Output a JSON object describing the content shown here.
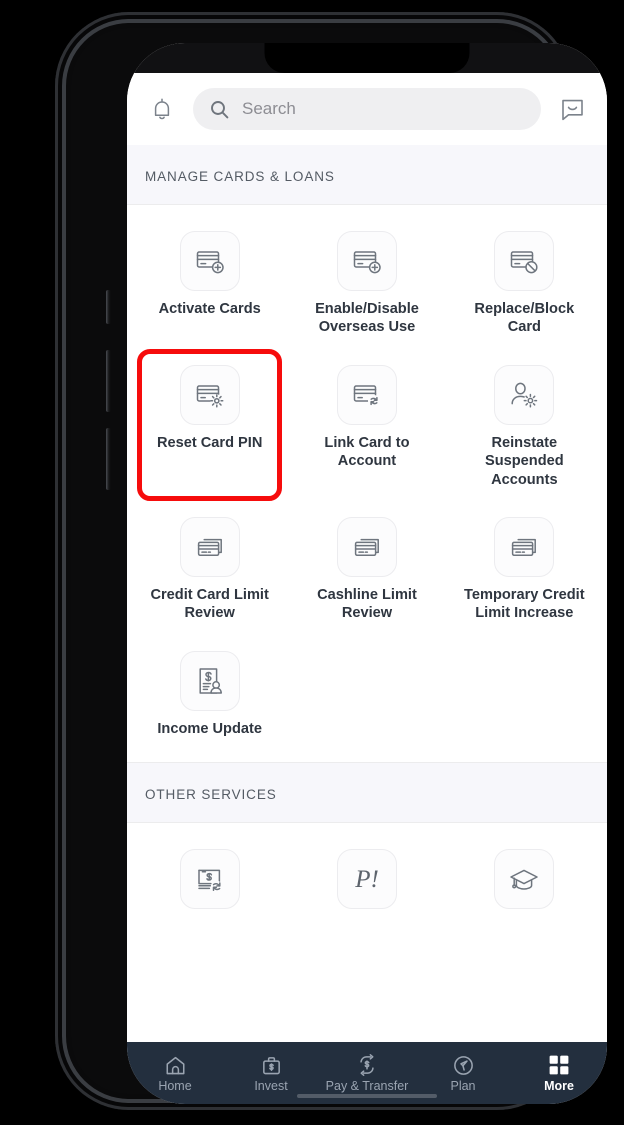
{
  "app": {
    "appbar": {
      "notifications_icon": "bell-icon",
      "chat_icon": "chat-bubble-icon",
      "search": {
        "icon": "search-icon",
        "placeholder": "Search",
        "value": ""
      }
    },
    "sections": [
      {
        "id": "manage-cards-loans",
        "title": "MANAGE CARDS & LOANS",
        "items": [
          {
            "label": "Activate Cards",
            "icon": "card-plus-icon",
            "highlighted": false
          },
          {
            "label": "Enable/Disable\nOverseas Use",
            "icon": "card-plus-icon",
            "highlighted": false
          },
          {
            "label": "Replace/Block\nCard",
            "icon": "card-block-icon",
            "highlighted": false
          },
          {
            "label": "Reset Card PIN",
            "icon": "card-gear-icon",
            "highlighted": true
          },
          {
            "label": "Link Card to\nAccount",
            "icon": "card-refresh-icon",
            "highlighted": false
          },
          {
            "label": "Reinstate\nSuspended\nAccounts",
            "icon": "person-gear-icon",
            "highlighted": false
          },
          {
            "label": "Credit Card Limit\nReview",
            "icon": "cards-stack-icon",
            "highlighted": false
          },
          {
            "label": "Cashline Limit\nReview",
            "icon": "cards-stack-icon",
            "highlighted": false
          },
          {
            "label": "Temporary Credit\nLimit Increase",
            "icon": "cards-stack-icon",
            "highlighted": false
          },
          {
            "label": "Income Update",
            "icon": "income-document-icon",
            "highlighted": false
          }
        ]
      },
      {
        "id": "other-services",
        "title": "OTHER SERVICES",
        "items": [
          {
            "label": "",
            "icon": "cheque-refresh-icon",
            "highlighted": false
          },
          {
            "label": "",
            "icon": "paylah-icon",
            "highlighted": false
          },
          {
            "label": "",
            "icon": "graduation-cap-icon",
            "highlighted": false
          }
        ]
      }
    ],
    "tabbar": {
      "items": [
        {
          "label": "Home",
          "icon": "home-icon",
          "active": false
        },
        {
          "label": "Invest",
          "icon": "briefcase-icon",
          "active": false
        },
        {
          "label": "Pay & Transfer",
          "icon": "transfer-icon",
          "active": false
        },
        {
          "label": "Plan",
          "icon": "compass-icon",
          "active": false
        },
        {
          "label": "More",
          "icon": "grid-icon",
          "active": true
        }
      ]
    },
    "colors": {
      "tabbar_bg": "#232f3e",
      "highlight": "#f60c0c",
      "section_header_bg": "#f7f7fb",
      "search_bg": "#efeff1",
      "label_text": "#2f3640",
      "icon_stroke": "#6e757e"
    }
  }
}
